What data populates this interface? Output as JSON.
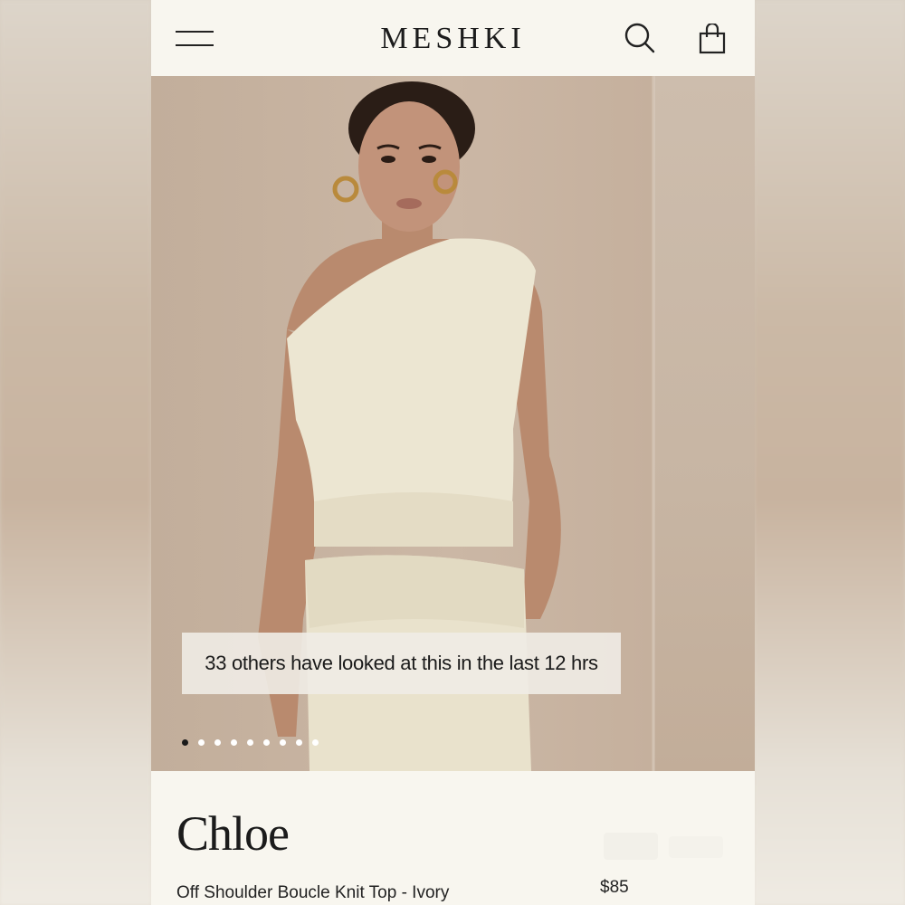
{
  "header": {
    "logo": "MESHKI",
    "menu_icon": "hamburger-menu-icon",
    "search_icon": "search-icon",
    "bag_icon": "shopping-bag-icon"
  },
  "gallery": {
    "view_notice": "33 others have looked at this in the last 12 hrs",
    "slide_count": 9,
    "active_slide": 1
  },
  "product": {
    "name": "Chloe",
    "description": "Off Shoulder Boucle Knit Top - Ivory",
    "price": "$85"
  },
  "colors": {
    "background": "#f8f6ef",
    "text": "#1b1b1b",
    "hero_bg": "#c5b09d",
    "garment": "#ece6d2",
    "skin": "#b98a6e"
  }
}
